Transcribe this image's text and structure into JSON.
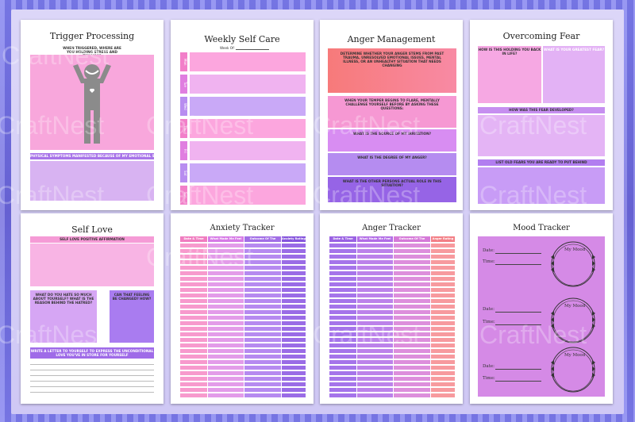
{
  "watermark": "CraftNest",
  "pages": {
    "trigger": {
      "title": "Trigger Processing",
      "q1": "When triggered, where are you holding stress and tension?",
      "q2": "Physical symptoms manifested because of my emotional stress"
    },
    "selfcare": {
      "title": "Weekly Self Care",
      "week": "Week Of:",
      "days": [
        "Mon",
        "Tue",
        "Wed",
        "Thu",
        "Fri",
        "Sat",
        "Sun"
      ]
    },
    "anger_mgmt": {
      "title": "Anger Management",
      "q1": "Determine whether your anger stems from past trauma, unresolved emotional issues, mental illness, or an unhealthy situation that needs changing",
      "q2": "When your temper begins to flare, mentally challenge yourself before by asking these questions:",
      "q3": "What is the source of my irritation?",
      "q4": "What is the degree of my anger?",
      "q5": "What is the other persons actual role in this situation?"
    },
    "fear": {
      "title": "Overcoming Fear",
      "q1": "How is this holding you back in life?",
      "q2": "What is your greatest fear?",
      "q3": "How was this fear developed?",
      "q4": "List old fears you are ready to put behind"
    },
    "selflove": {
      "title": "Self Love",
      "q1": "Self love positive affirmation",
      "q2": "What do you hate so much about yourself? What is the reason behind the hatred?",
      "q3": "Can that feeling be changed? How?",
      "q4": "Write a letter to yourself to express the unconditional love you've in store for yourself"
    },
    "anxiety": {
      "title": "Anxiety Tracker",
      "cols": [
        "Date & Time",
        "What Made Me Feel Anxious",
        "Outcome Of The Situation",
        "Anxiety Rating"
      ]
    },
    "anger": {
      "title": "Anger Tracker",
      "cols": [
        "Date & Time",
        "What Made Me Feel Angry?",
        "Outcome Of The Situation",
        "Anger Rating"
      ]
    },
    "mood": {
      "title": "Mood Tracker",
      "date": "Date:",
      "time": "Time:",
      "mymood": "My Mood"
    }
  }
}
